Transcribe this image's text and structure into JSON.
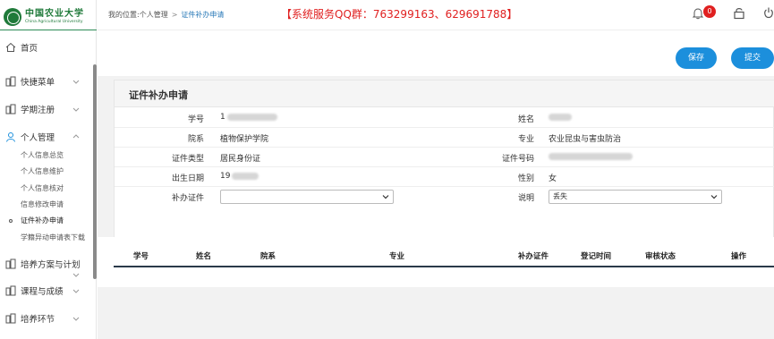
{
  "logo": {
    "cn": "中国农业大学",
    "en": "China Agricultural University"
  },
  "sidebar": {
    "items": [
      {
        "label": "首页",
        "icon": "home-icon"
      },
      {
        "label": "快捷菜单",
        "icon": "grid-icon"
      },
      {
        "label": "学期注册",
        "icon": "grid-icon"
      },
      {
        "label": "个人管理",
        "icon": "person-icon"
      },
      {
        "label": "培养方案与计划",
        "icon": "grid-icon"
      },
      {
        "label": "课程与成绩",
        "icon": "grid-icon"
      },
      {
        "label": "培养环节",
        "icon": "grid-icon"
      }
    ],
    "subitems": [
      "个人信息总览",
      "个人信息维护",
      "个人信息核对",
      "信息修改申请",
      "证件补办申请",
      "学籍异动申请表下载"
    ]
  },
  "header": {
    "breadcrumb": {
      "prefix": "我的位置:",
      "parent": "个人管理",
      "sep": ">",
      "current": "证件补办申请"
    },
    "notice": "【系统服务QQ群：763299163、629691788】",
    "badge_count": "0"
  },
  "toolbar": {
    "save_label": "保存",
    "submit_label": "提交"
  },
  "panel": {
    "title": "证件补办申请"
  },
  "form": {
    "student_id_label": "学号",
    "student_id_value": "1",
    "name_label": "姓名",
    "name_value": "",
    "department_label": "院系",
    "department_value": "植物保护学院",
    "major_label": "专业",
    "major_value": "农业昆虫与害虫防治",
    "id_type_label": "证件类型",
    "id_type_value": "居民身份证",
    "id_number_label": "证件号码",
    "id_number_value": "",
    "birthdate_label": "出生日期",
    "birthdate_value": "19",
    "gender_label": "性别",
    "gender_value": "女",
    "reissue_label": "补办证件",
    "reissue_value": "",
    "remark_label": "说明",
    "remark_value": "丢失"
  },
  "table": {
    "headers": [
      "学号",
      "姓名",
      "院系",
      "专业",
      "补办证件",
      "登记时间",
      "审核状态",
      "操作"
    ]
  },
  "colors": {
    "accent": "#1c8fdc",
    "brand": "#1f7a3a",
    "notice": "#e02020"
  }
}
